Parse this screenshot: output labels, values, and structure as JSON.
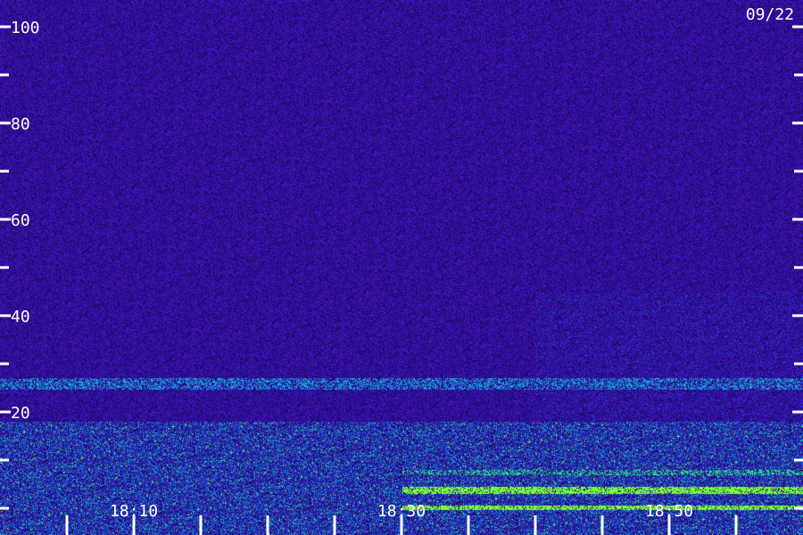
{
  "date_label": "09/22",
  "colors": {
    "background": "#1a0a6e",
    "noise_dark": "#0a0440",
    "noise_light": "#4a22c8",
    "band_cyan": "#1ad6e8",
    "band_green": "#7cff3c",
    "tick": "#ffffff"
  },
  "chart_data": {
    "type": "heatmap",
    "title": "",
    "xlabel": "",
    "ylabel": "",
    "ylim": [
      0,
      100
    ],
    "y_ticks_major": [
      {
        "value": 100,
        "label": "100"
      },
      {
        "value": 80,
        "label": "80"
      },
      {
        "value": 60,
        "label": "60"
      },
      {
        "value": 40,
        "label": "40"
      },
      {
        "value": 20,
        "label": "20"
      }
    ],
    "y_ticks_minor": [
      90,
      70,
      50,
      30,
      10,
      0
    ],
    "x_time_labels": [
      {
        "time": "18:10",
        "label": "18:10"
      },
      {
        "time": "18:30",
        "label": "18:30"
      },
      {
        "time": "18:50",
        "label": "18:50"
      }
    ],
    "xlim": [
      "18:00",
      "18:60"
    ],
    "x_tick_interval_min": 5,
    "bands": [
      {
        "y_low": 25,
        "y_high": 27,
        "intensity": "moderate",
        "extent": "full"
      },
      {
        "y_low": 0,
        "y_high": 18,
        "intensity": "high",
        "extent": "full"
      },
      {
        "y_low": 3,
        "y_high": 5,
        "intensity": "very high",
        "extent": "from 18:30"
      },
      {
        "y_low": 0,
        "y_high": 1,
        "intensity": "very high",
        "extent": "from 18:30"
      }
    ]
  }
}
